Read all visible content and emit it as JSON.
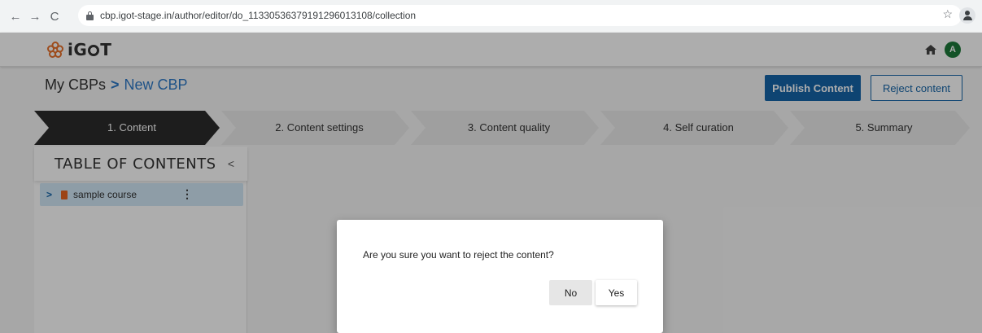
{
  "browser": {
    "back_icon": "arrow-left",
    "forward_icon": "arrow-right",
    "reload_icon": "reload",
    "url": "cbp.igot-stage.in/author/editor/do_11330536379191296013108/collection"
  },
  "header": {
    "logo_text": "iG",
    "logo_text_end": "T",
    "avatar_initial": "A"
  },
  "breadcrumb": {
    "parent": "My CBPs",
    "separator": ">",
    "current": "New CBP"
  },
  "actions": {
    "publish_label": "Publish Content",
    "reject_label": "Reject content"
  },
  "stepper": {
    "steps": [
      {
        "label": "1. Content"
      },
      {
        "label": "2. Content settings"
      },
      {
        "label": "3. Content quality"
      },
      {
        "label": "4. Self curation"
      },
      {
        "label": "5. Summary"
      }
    ],
    "active_index": 0
  },
  "toc": {
    "title": "TABLE OF CONTENTS",
    "collapse_glyph": "<",
    "items": [
      {
        "label": "sample course",
        "expand_glyph": ">",
        "menu_glyph": "⋮"
      }
    ]
  },
  "dialog": {
    "message": "Are you sure you want to reject the content?",
    "no_label": "No",
    "yes_label": "Yes"
  },
  "colors": {
    "brand_blue": "#1565a8",
    "active_step": "#2b2b2b",
    "toc_item_bg": "#d2e8f7",
    "avatar_bg": "#1c7a3a"
  }
}
